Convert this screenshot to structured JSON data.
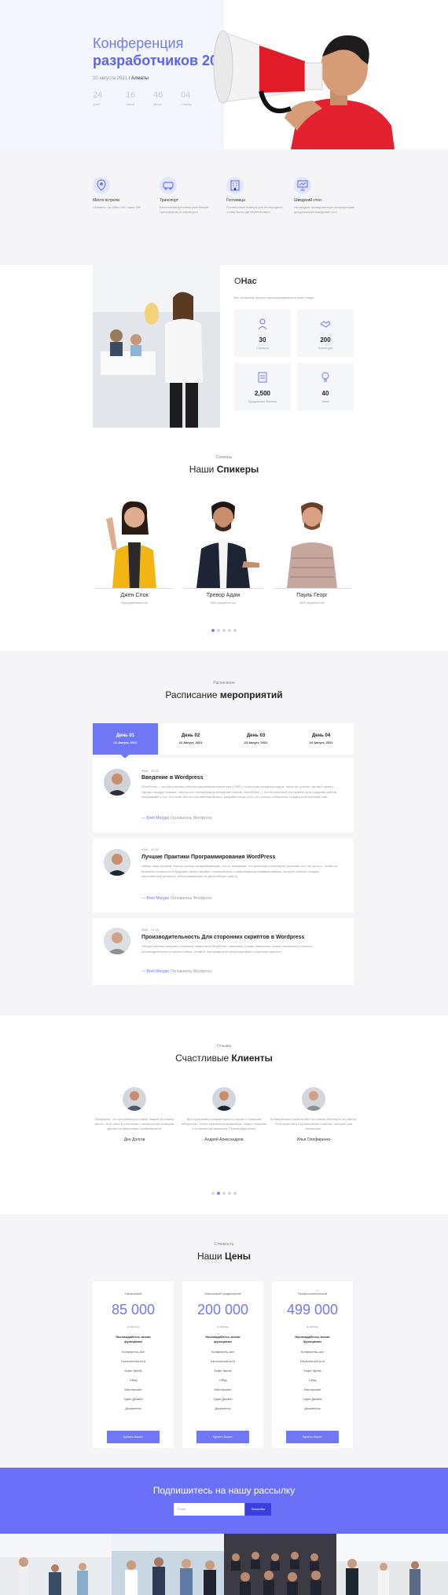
{
  "hero": {
    "title_line1": "Конференция",
    "title_line2": "разработчиков 2021",
    "date_prefix": "20 августа 2021",
    "date_city": "/ Алматы",
    "countdown": [
      {
        "value": "24",
        "label": "Дней"
      },
      {
        "value": "16",
        "label": "Часов"
      },
      {
        "value": "46",
        "label": "Минут"
      },
      {
        "value": "04",
        "label": "Секунд"
      }
    ]
  },
  "features": [
    {
      "icon": "location-pin-icon",
      "title": "Место встречи",
      "desc": "г.Алматы, пр.Абая 150, офис 300"
    },
    {
      "icon": "transport-icon",
      "title": "Транспорт",
      "desc": "Бесплатная доставка участников трансфером от аэропорта"
    },
    {
      "icon": "hotel-icon",
      "title": "Гостиница",
      "desc": "Гостиничные номера для иногородних, чтобы было где переночевать"
    },
    {
      "icon": "presentation-icon",
      "title": "Шведский стол",
      "desc": "На каждую тренировочную конференцию предусмотрен шведский стол"
    }
  ],
  "about": {
    "title_first": "О",
    "title_rest": "Нас",
    "subtitle": "Мы собираем лучших проектировщиков из всего мира",
    "stats": [
      {
        "value": "30",
        "label": "Спикеры",
        "icon": "speaker-icon"
      },
      {
        "value": "200",
        "label": "Спонсоры",
        "icon": "handshake-icon"
      },
      {
        "value": "2,500",
        "label": "Продажные билеты",
        "icon": "ticket-icon"
      },
      {
        "value": "40",
        "label": "Темы",
        "icon": "bulb-icon"
      }
    ]
  },
  "speakers": {
    "small": "Спикеры",
    "title_prefix": "Наши",
    "title_bold": "Спикеры",
    "items": [
      {
        "name": "Джен Слок",
        "role": "Предприниматель"
      },
      {
        "name": "Тревор Адам",
        "role": "Веб разработчик"
      },
      {
        "name": "Пауль Георг",
        "role": "Веб разработчик"
      }
    ]
  },
  "schedule": {
    "small": "Расписание",
    "title_prefix": "Расписание",
    "title_bold": "мероприятий",
    "tabs": [
      {
        "title": "День 01",
        "date": "21 Август, 2021"
      },
      {
        "title": "День 02",
        "date": "22 Август, 2021"
      },
      {
        "title": "День 03",
        "date": "23 Август, 2021"
      },
      {
        "title": "День 04",
        "date": "24 Август, 2021"
      }
    ],
    "events": [
      {
        "time": "9AM - 10:30",
        "title": "Введение в Wordpress",
        "desc": "WordPress — это бесплатная система управления контентом (CMS) с открытым исходным кодом, такая же основа, как веб-сервер. Однако гораздо больше, чем просто платформа для ведения блогов. WordPress — это бесплатный инструмент для создания сайтов, популярный у тех, кто хочет вести собственный бизнес, разработчиков и тех, кто только собирается создать собственный сайт.",
        "by_prefix": "—",
        "speaker": "Brett Morgan",
        "role": "Основатель Wordpress"
      },
      {
        "time": "9AM - 10:30",
        "title": "Лучшие Практики Программирования WordPress",
        "desc": "Набор таких практик нельзя считать исчерпывающим. Что ж, понимаем, что выполнить некоторые решения есть не просто. Чтобы не возникли сложности в будущем, важно заранее ознакомиться с практиками программирования, которые помогут создать качественные решения, обеспечивающие их дальнейшую работу.",
        "by_prefix": "—",
        "speaker": "Brett Morgan",
        "role": "Основатель Wordpress"
      },
      {
        "time": "9AM - 10:30",
        "title": "Производительность Для сторонних скриптов в Wordpress",
        "desc": "Общая рабочая нагрузка сторонних скриптов в WordPress, например, в виде аналитики, может значительно снизить производительность вашего сайта. Узнайте, как правильно контролировать сторонние скрипты.",
        "by_prefix": "—",
        "speaker": "Brett Morgan",
        "role": "Основатель Wordpress"
      }
    ]
  },
  "testimonials": {
    "small": "Отзывы",
    "title_prefix": "Счастливые",
    "title_bold": "Клиенты",
    "items": [
      {
        "text": "Прекрасно, что организаторы ставят людей на первое место. Этот опыт в сочетании с экспертизой спикеров сделал конференцию незабываемой.",
        "name": "Ден Долгов"
      },
      {
        "text": "Всю программу конференции я слушал с большим интересом. Очень полезная информация, живое общение и отличная организация. Рекомендую всем.",
        "name": "Андрей Александров"
      },
      {
        "text": "Конференция помогла мне по-новому взглянуть на работу. Я получил много практических советов, которые уже использую.",
        "name": "Илья Олефиренко"
      }
    ]
  },
  "pricing": {
    "small": "Стоимость",
    "title_prefix": "Наши",
    "title_bold": "Цены",
    "plans": [
      {
        "name": "Начальный",
        "price": "85 000",
        "per": "в месяц",
        "includes": "Наслаждайтесь всеми функциями",
        "features": [
          "Конференц-зал",
          "Бесплатный wi-fi",
          "Кофе брейк",
          "Обед",
          "Мастерские",
          "Один Дизайн",
          "Документы"
        ],
        "button": "Купить Билет"
      },
      {
        "name": "Начальный продвинутый",
        "price": "200 000",
        "per": "в месяц",
        "includes": "Наслаждайтесь всеми функциями",
        "features": [
          "Конференц-зал",
          "Бесплатный wi-fi",
          "Кофе брейк",
          "Обед",
          "Мастерские",
          "Один Дизайн",
          "Документы"
        ],
        "button": "Купить Билет"
      },
      {
        "name": "Профессиональный",
        "price": "499 000",
        "per": "в месяц",
        "includes": "Наслаждайтесь всеми функциями",
        "features": [
          "Конференц-зал",
          "Бесплатный wi-fi",
          "Кофе брейк",
          "Обед",
          "Мастерские",
          "Один Дизайн",
          "Документы"
        ],
        "button": "Купить Билет"
      }
    ]
  },
  "newsletter": {
    "title": "Подпишитесь на нашу рассылку",
    "placeholder": "Email",
    "button": "Subscribe"
  },
  "colors": {
    "accent": "#6f77f5",
    "light_bg": "#f5f5f7",
    "hero_bg": "#f3f5ff"
  }
}
